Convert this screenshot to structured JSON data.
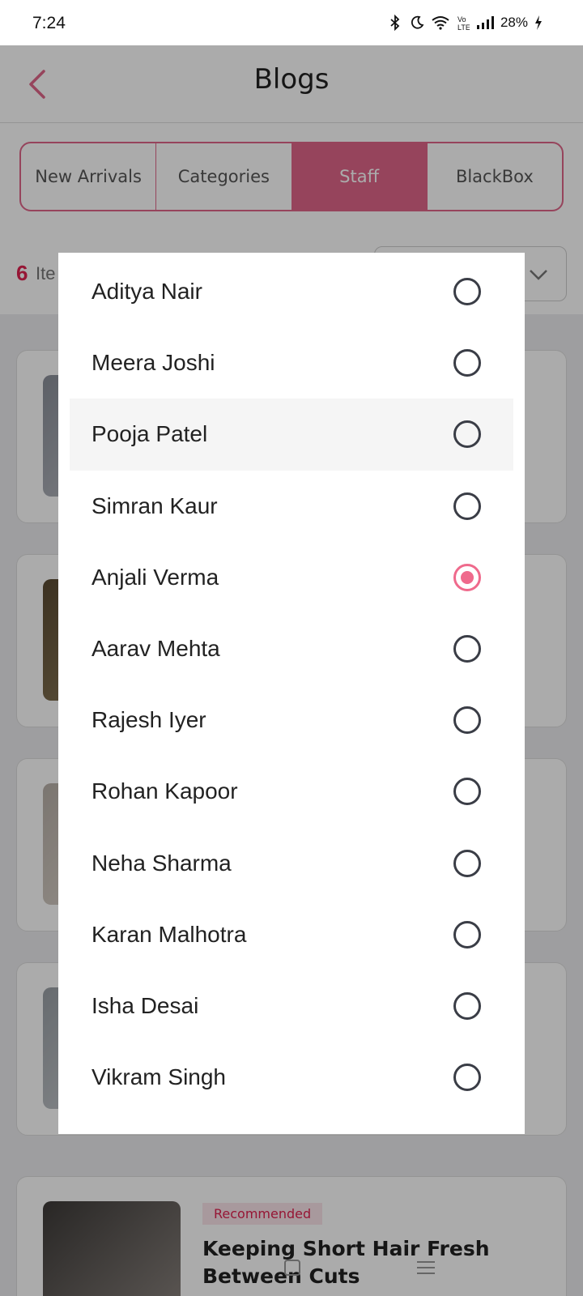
{
  "status_bar": {
    "time": "7:24",
    "battery": "28%"
  },
  "header": {
    "title": "Blogs",
    "back_icon": "chevron-left-icon"
  },
  "tabs": [
    {
      "label": "New Arrivals",
      "active": false
    },
    {
      "label": "Categories",
      "active": false
    },
    {
      "label": "Staff",
      "active": true
    },
    {
      "label": "BlackBox",
      "active": false
    }
  ],
  "items": {
    "count": "6",
    "label": "Ite"
  },
  "background_card": {
    "badge": "Recommended",
    "title": "Keeping Short Hair Fresh Between Cuts"
  },
  "staff_dialog": {
    "options": [
      {
        "name": "Aditya Nair",
        "selected": false
      },
      {
        "name": "Meera Joshi",
        "selected": false
      },
      {
        "name": "Pooja Patel",
        "selected": false
      },
      {
        "name": "Simran Kaur",
        "selected": false
      },
      {
        "name": "Anjali Verma",
        "selected": true
      },
      {
        "name": "Aarav Mehta",
        "selected": false
      },
      {
        "name": "Rajesh Iyer",
        "selected": false
      },
      {
        "name": "Rohan Kapoor",
        "selected": false
      },
      {
        "name": "Neha Sharma",
        "selected": false
      },
      {
        "name": "Karan Malhotra",
        "selected": false
      },
      {
        "name": "Isha Desai",
        "selected": false
      },
      {
        "name": "Vikram Singh",
        "selected": false
      }
    ]
  },
  "colors": {
    "accent": "#e0668a",
    "radio_selected": "#ef6a8c",
    "count_red": "#e0214f"
  }
}
